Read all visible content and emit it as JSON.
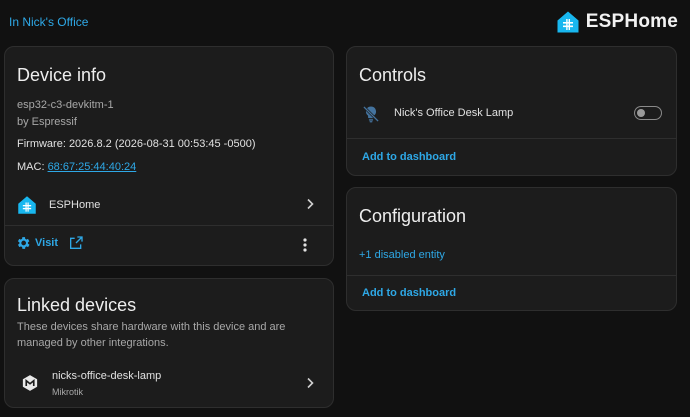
{
  "header": {
    "area_link": "In Nick's Office",
    "brand_name": "ESPHome",
    "brand_icon": "esphome-house-icon"
  },
  "device_info": {
    "title": "Device info",
    "model": "esp32-c3-devkitm-1",
    "manufacturer": "by Espressif",
    "firmware": "Firmware: 2026.8.2 (2026-08-31 00:53:45 -0500)",
    "mac_label": "MAC:",
    "mac_value": "68:67:25:44:40:24",
    "integration": {
      "label": "ESPHome",
      "icon": "esphome-house-icon"
    },
    "visit_label": "Visit",
    "visit_icon": "gear-icon",
    "external_icon": "open-in-new-icon",
    "more_icon": "more-vertical-icon"
  },
  "linked_devices": {
    "title": "Linked devices",
    "description": "These devices share hardware with this device and are managed by other integrations.",
    "items": [
      {
        "name": "nicks-office-desk-lamp",
        "manufacturer": "Mikrotik",
        "icon": "mikrotik-icon"
      }
    ]
  },
  "controls": {
    "title": "Controls",
    "entities": [
      {
        "name": "Nick's Office Desk Lamp",
        "icon": "lightbulb-off-icon",
        "state": "off"
      }
    ],
    "add_to_dashboard": "Add to dashboard"
  },
  "configuration": {
    "title": "Configuration",
    "disabled_entities": "+1 disabled entity",
    "add_to_dashboard": "Add to dashboard"
  },
  "colors": {
    "background": "#111111",
    "card": "#1c1c1c",
    "accent": "#2ea8e6",
    "brand_blue": "#18b7ef"
  }
}
